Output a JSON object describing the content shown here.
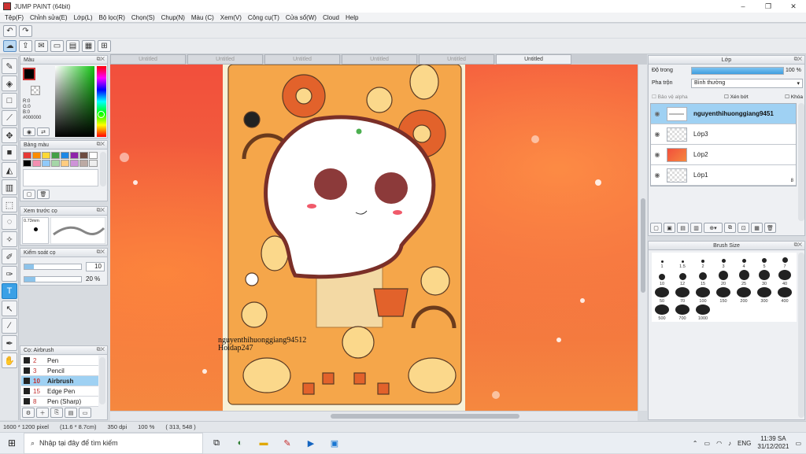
{
  "window": {
    "title": "JUMP PAINT (64bit)",
    "minimize": "–",
    "maximize": "❐",
    "close": "✕"
  },
  "menu": [
    "Tệp(F)",
    "Chỉnh sửa(E)",
    "Lớp(L)",
    "Bộ lọc(R)",
    "Chọn(S)",
    "Chụp(N)",
    "Màu (C)",
    "Xem(V)",
    "Công cụ(T)",
    "Cửa sổ(W)",
    "Cloud",
    "Help"
  ],
  "toolbar": {
    "undo_icon": "undo-icon",
    "redo_icon": "redo-icon"
  },
  "tabs": [
    "Untitled",
    "Untitled",
    "Untitled",
    "Untitled",
    "Untitled",
    "Untitled"
  ],
  "color_panel": {
    "title": "Màu",
    "rgb": [
      "R:0",
      "G:0",
      "B:0"
    ],
    "hex": "#000000",
    "current_color": "#000000"
  },
  "palette_panel": {
    "title": "Bảng màu",
    "swatches": [
      "#e53935",
      "#fb8c00",
      "#fdd835",
      "#43a047",
      "#1e88e5",
      "#8e24aa",
      "#6d4c41",
      "#ffffff",
      "#000000",
      "#f48fb1",
      "#90caf9",
      "#a5d6a7",
      "#ffcc80",
      "#ce93d8",
      "#bcaaa4",
      "#eeeeee"
    ]
  },
  "preview_panel": {
    "title": "Xem trước cọ",
    "size_label": "0.73mm"
  },
  "brush_control": {
    "title": "Kiểm soát cọ",
    "value1": "10",
    "value2": "20 %"
  },
  "brush_list": {
    "title": "Cọ: Airbrush",
    "items": [
      {
        "num": "2",
        "name": "Pen"
      },
      {
        "num": "3",
        "name": "Pencil"
      },
      {
        "num": "10",
        "name": "Airbrush"
      },
      {
        "num": "15",
        "name": "Edge Pen"
      },
      {
        "num": "8",
        "name": "Pen (Sharp)"
      }
    ],
    "selected_index": 2
  },
  "layer_panel": {
    "title": "Lớp",
    "opacity_label": "Độ trong",
    "opacity_value": "100 %",
    "opacity_percent": 100,
    "blend_label": "Pha trộn",
    "blend_value": "Bình thường",
    "protect_alpha": "Bảo vệ alpha",
    "clip": "Xén bớt",
    "lock": "Khóa",
    "layers": [
      "nguyenthihuonggiang9451",
      "Lớp3",
      "Lớp2",
      "Lớp1"
    ],
    "selected_index": 0,
    "layer1_badge": "8"
  },
  "brush_size_panel": {
    "title": "Brush Size",
    "sizes": [
      "1",
      "1.5",
      "2",
      "3",
      "4",
      "5",
      "7",
      "10",
      "12",
      "15",
      "20",
      "25",
      "30",
      "40",
      "50",
      "70",
      "100",
      "150",
      "200",
      "300",
      "400",
      "500",
      "700",
      "1000"
    ]
  },
  "artwork": {
    "watermark_line1": "nguyenthihuonggiang94512",
    "watermark_line2": "Hoidap247"
  },
  "status": {
    "size": "1600 * 1200 pixel",
    "cm": "(11.6 * 8.7cm)",
    "dpi": "350 dpi",
    "zoom": "100 %",
    "coords": "( 313, 548 )"
  },
  "taskbar": {
    "search_placeholder": "Nhập tại đây để tìm kiếm",
    "lang": "ENG",
    "time": "11:39 SA",
    "date": "31/12/2021"
  }
}
